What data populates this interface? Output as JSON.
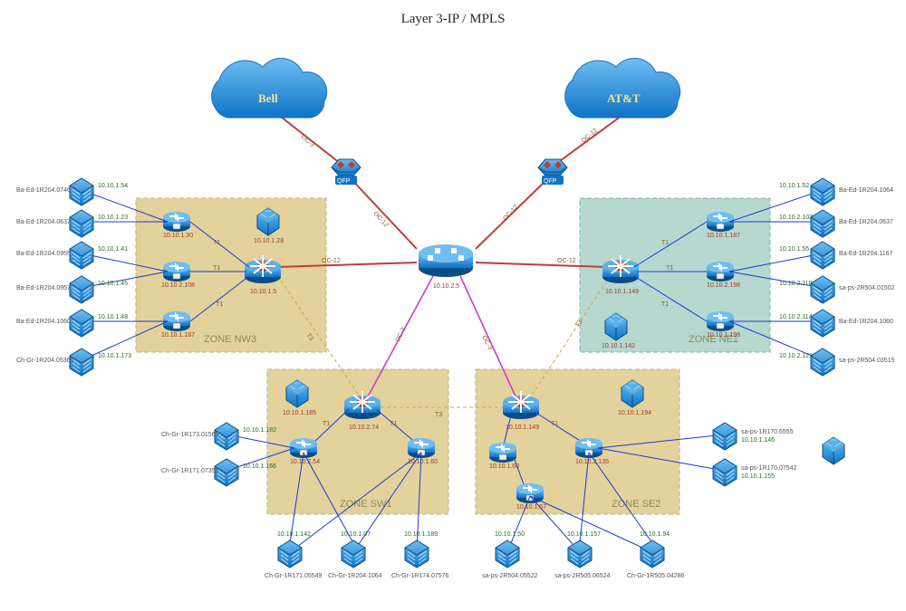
{
  "title": "Layer 3-IP / MPLS",
  "clouds": {
    "bell": "Bell",
    "att": "AT&T"
  },
  "qfp": "QFP",
  "core_ip": "10.10.2.5",
  "zones": {
    "nw3": {
      "label": "ZONE NW3",
      "distro_ip": "10.10.1.5",
      "server_ip": "10.10.1.28",
      "routers": [
        "10.10.1.30",
        "10.10.2.108",
        "10.10.1.187"
      ],
      "satellites": [
        {
          "host": "Ba-Ed-1R204.0746",
          "ip": "10.10.1.54"
        },
        {
          "host": "Ba-Ed-1R204.0637",
          "ip": "10.10.1.23"
        },
        {
          "host": "Ba-Ed-1R204.0955",
          "ip": "10.10.1.41"
        },
        {
          "host": "Ba-Ed-1R204.0957",
          "ip": "10.10.1.45"
        },
        {
          "host": "Ba-Ed-1R204.1060",
          "ip": "10.10.1.48"
        },
        {
          "host": "Ch-Gr-1R204.05360",
          "ip": "10.10.1.173"
        }
      ]
    },
    "ne1": {
      "label": "ZONE NE1",
      "distro_ip": "10.10.1.149",
      "server_ip": "10.10.1.142",
      "routers": [
        "10.10.1.187",
        "10.10.2.198",
        "10.10.1.198"
      ],
      "satellites": [
        {
          "host": "Ba-Ed-1R204.1064",
          "ip": "10.10.1.52"
        },
        {
          "host": "Ba-Ed-1R204.0637",
          "ip": "10.10.2.103"
        },
        {
          "host": "Ba-Ed-1R204.1167",
          "ip": "10.10.1.55"
        },
        {
          "host": "sa-ps-2R504.01502",
          "ip": "10.10.2.110"
        },
        {
          "host": "Ba-Ed-1R204.1060",
          "ip": "10.10.2.114"
        },
        {
          "host": "sa-ps-2R504.03515",
          "ip": "10.10.2.121"
        }
      ]
    },
    "sw1": {
      "label": "ZONE SW1",
      "distro_ip": "10.10.2.74",
      "server_ip": "10.10.1.185",
      "routers": [
        "10.10.2.54",
        "10.10.1.60"
      ],
      "satellites_l": [
        {
          "host": "Ch-Gr-1R173.01565",
          "ip": "10.10.1.182"
        },
        {
          "host": "Ch-Gr-1R171.07355",
          "ip": "10.10.1.166"
        }
      ],
      "satellites_b": [
        {
          "host": "Ch-Gr-1R171.05549",
          "ip": "10.10.1.142"
        },
        {
          "host": "Ch-Gr-1R204.1064",
          "ip": "10.10.1.07"
        },
        {
          "host": "Ch-Gr-1R174.07576",
          "ip": "10.10.1.189"
        }
      ]
    },
    "se2": {
      "label": "ZONE SE2",
      "distro_ip": "10.10.1.149",
      "server_ip": "10.10.1.194",
      "routers": [
        "10.10.1.60",
        "10.10.2.135",
        "10.10.1.57"
      ],
      "satellites_r": [
        {
          "host": "sa-ps-1R170.6555",
          "ip": "10.10.1.146"
        },
        {
          "host": "sa-ps-1R170.07542",
          "ip": "10.10.1.155"
        }
      ],
      "satellites_b": [
        {
          "host": "sa-ps-2R504.05522",
          "ip": "10.10.1.50"
        },
        {
          "host": "sa-ps-2R505.06524",
          "ip": "10.10.1.157"
        },
        {
          "host": "Ch-Gr-1R505.04286",
          "ip": "10.10.1.94"
        }
      ]
    }
  },
  "linklabels": {
    "oc12": "OC-12",
    "oc3": "OC-3",
    "t1": "T1",
    "t3": "T3"
  }
}
